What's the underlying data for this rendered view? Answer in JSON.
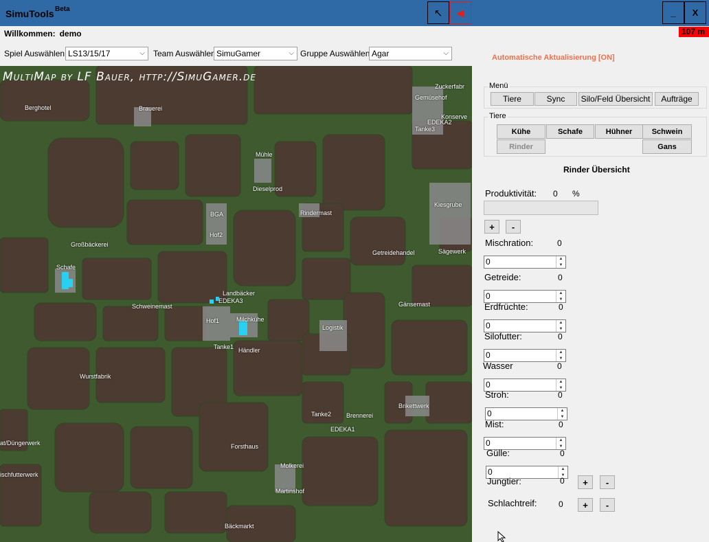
{
  "window": {
    "title": "SimuTools",
    "badge": "Beta",
    "minimize_label": "_",
    "close_label": "X",
    "nav_back_glyph": "↖",
    "nav_left_glyph": "◀"
  },
  "welcome": {
    "label": "Willkommen:",
    "user": "demo"
  },
  "ping": "107 m",
  "selects": {
    "game": {
      "label": "Spiel Auswählen:",
      "value": "LS13/15/17"
    },
    "team": {
      "label": "Team Auswählen:",
      "value": "SimuGamer"
    },
    "group": {
      "label": "Gruppe Auswählen:",
      "value": "Agar"
    }
  },
  "auto_update": "Automatische Aktualisierung [ON]",
  "map": {
    "title": "MultiMap by LF Bauer, http://SimuGamer.de",
    "labels": [
      "Berghotel",
      "Brauerei",
      "Zuckerfabr",
      "Gemüsehof",
      "Konserve",
      "EDEKA2",
      "Tanke3",
      "Mühle",
      "Dieselprod",
      "BGA",
      "Hof2",
      "Rindermast",
      "Kiesgrube",
      "Großbäckerei",
      "Getreidehandel",
      "Sägewerk",
      "Schafe",
      "Landbäcker",
      "EDEKA3",
      "Schweinemast",
      "Gänsemast",
      "Hof1",
      "Milchkühe",
      "Logistik",
      "Tanke1",
      "Händler",
      "Wurstfabrik",
      "Brikettwerk",
      "Tanke2",
      "Brennerei",
      "EDEKA1",
      "at/Düngerwerk",
      "Forsthaus",
      "ischfutterwerk",
      "Molkerei",
      "Martinshof",
      "Bäckmarkt"
    ]
  },
  "menu": {
    "title": "Menü",
    "buttons": [
      "Tiere",
      "Sync",
      "Silo/Feld Übersicht",
      "Aufträge"
    ]
  },
  "animals": {
    "title": "Tiere",
    "buttons": [
      "Kühe",
      "Schafe",
      "Hühner",
      "Schwein",
      "Rinder",
      "Gans"
    ]
  },
  "overview": {
    "title": "Rinder Übersicht",
    "productivity_label": "Produktivität:",
    "productivity_value": "0",
    "productivity_unit": "%",
    "productivity_fraction": 0,
    "plus": "+",
    "minus": "-",
    "fields": [
      {
        "label": "Mischration:",
        "value": "0",
        "input": "0"
      },
      {
        "label": "Getreide:",
        "value": "0",
        "input": "0"
      },
      {
        "label": "Erdfrüchte:",
        "value": "0",
        "input": "0"
      },
      {
        "label": "Silofutter:",
        "value": "0",
        "input": "0"
      },
      {
        "label": "Wasser",
        "value": "0",
        "input": "0"
      },
      {
        "label": "Stroh:",
        "value": "0",
        "input": "0"
      },
      {
        "label": "Mist:",
        "value": "0",
        "input": "0"
      },
      {
        "label": "Gülle:",
        "value": "0",
        "input": "0"
      }
    ],
    "young_label": "Jungtier:",
    "young_value": "0",
    "slaughter_label": "Schlachtreif:",
    "slaughter_value": "0"
  },
  "colors": {
    "titlebar": "#2f6aa6",
    "accent_orange": "#f0704a",
    "ping_bg": "#ff0000",
    "map_grass": "#3e5a2e",
    "map_field": "#4a3a30"
  }
}
